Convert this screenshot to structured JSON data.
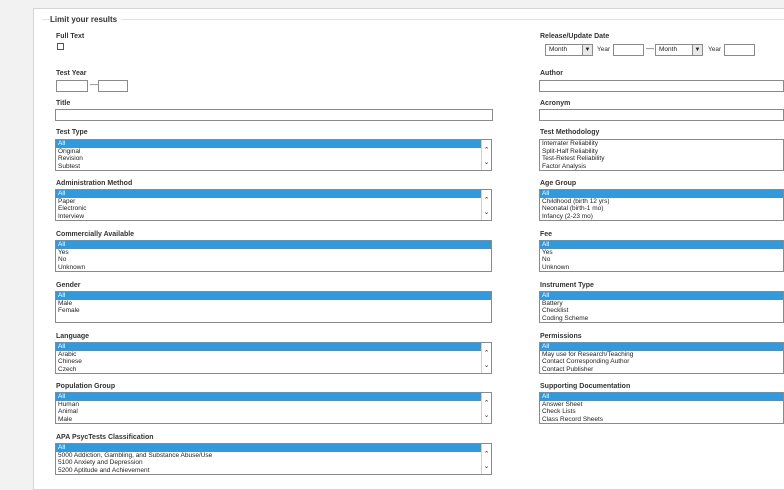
{
  "fieldset": {
    "legend": "Limit your results"
  },
  "full_text": {
    "label": "Full Text",
    "checked": false
  },
  "test_year": {
    "label": "Test Year",
    "from_value": "",
    "to_value": "",
    "separator": "—"
  },
  "title_field": {
    "label": "Title",
    "value": ""
  },
  "release_date": {
    "label": "Release/Update Date",
    "from_month": "Month",
    "from_year_label": "Year",
    "from_year": "",
    "separator": "—",
    "to_month": "Month",
    "to_year_label": "Year",
    "to_year": ""
  },
  "author": {
    "label": "Author",
    "value": ""
  },
  "acronym": {
    "label": "Acronym",
    "value": ""
  },
  "test_type": {
    "label": "Test Type",
    "options": [
      "All",
      "Original",
      "Revision",
      "Subtest"
    ],
    "selected": "All"
  },
  "test_methodology": {
    "label": "Test Methodology",
    "options": [
      "Interrater Reliability",
      "Split-Half Reliability",
      "Test-Retest Reliability",
      "Factor Analysis"
    ],
    "selected": ""
  },
  "administration_method": {
    "label": "Administration Method",
    "options": [
      "All",
      "Paper",
      "Electronic",
      "Interview"
    ],
    "selected": "All"
  },
  "age_group": {
    "label": "Age Group",
    "options": [
      "All",
      "Childhood (birth 12 yrs)",
      "Neonatal (birth-1 mo)",
      "Infancy (2-23 mo)"
    ],
    "selected": "All"
  },
  "commercially_available": {
    "label": "Commercially Available",
    "options": [
      "All",
      "Yes",
      "No",
      "Unknown"
    ],
    "selected": "All"
  },
  "fee": {
    "label": "Fee",
    "options": [
      "All",
      "Yes",
      "No",
      "Unknown"
    ],
    "selected": "All"
  },
  "gender": {
    "label": "Gender",
    "options": [
      "All",
      "Male",
      "Female"
    ],
    "selected": "All"
  },
  "instrument_type": {
    "label": "Instrument Type",
    "options": [
      "All",
      "Battery",
      "Checklist",
      "Coding Scheme"
    ],
    "selected": "All"
  },
  "language": {
    "label": "Language",
    "options": [
      "All",
      "Arabic",
      "Chinese",
      "Czech"
    ],
    "selected": "All"
  },
  "permissions": {
    "label": "Permissions",
    "options": [
      "All",
      "May use for Research/Teaching",
      "Contact Corresponding Author",
      "Contact Publisher"
    ],
    "selected": "All"
  },
  "population_group": {
    "label": "Population Group",
    "options": [
      "All",
      "Human",
      "Animal",
      "Male"
    ],
    "selected": "All"
  },
  "supporting_documentation": {
    "label": "Supporting Documentation",
    "options": [
      "All",
      "Answer Sheet",
      "Check Lists",
      "Class Record Sheets"
    ],
    "selected": "All"
  },
  "apa_classification": {
    "label": "APA PsycTests Classification",
    "options": [
      "All",
      "5000 Addiction, Gambling, and Substance Abuse/Use",
      "5100 Anxiety and Depression",
      "5200 Aptitude and Achievement"
    ],
    "selected": "All"
  },
  "colors": {
    "selected_option": "#3399dd",
    "border": "#8a8a8a"
  }
}
